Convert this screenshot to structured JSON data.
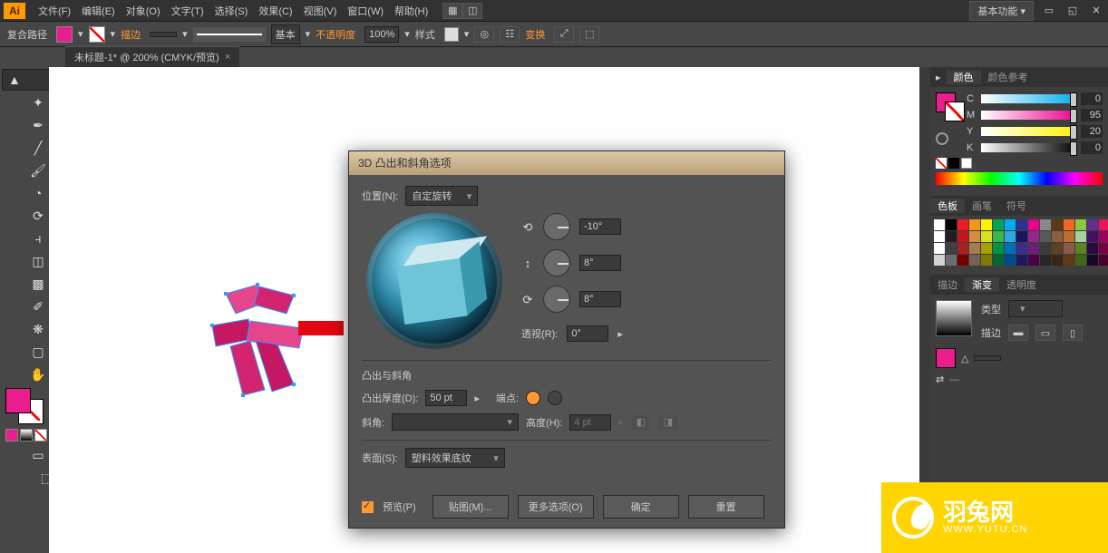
{
  "menubar": {
    "items": [
      "文件(F)",
      "编辑(E)",
      "对象(O)",
      "文字(T)",
      "选择(S)",
      "效果(C)",
      "视图(V)",
      "窗口(W)",
      "帮助(H)"
    ],
    "basic": "基本功能"
  },
  "controlbar": {
    "mode": "复合路径",
    "stroke_label": "描边",
    "stroke_val": "",
    "basic": "基本",
    "opacity_label": "不透明度",
    "opacity_val": "100%",
    "style_label": "样式",
    "transform_label": "变换"
  },
  "doc_tab": "未标题-1* @ 200% (CMYK/预览)",
  "panels": {
    "color": {
      "tab": "颜色",
      "guide": "颜色参考",
      "c": "C",
      "m": "M",
      "y": "Y",
      "k": "K",
      "cv": "0",
      "mv": "95",
      "yv": "20",
      "kv": "0"
    },
    "swatches": {
      "tabs": [
        "色板",
        "画笔",
        "符号"
      ]
    },
    "stroke": {
      "tabs": [
        "描边",
        "渐变",
        "透明度"
      ],
      "type": "类型",
      "edge": "描边"
    }
  },
  "dialog": {
    "title": "3D 凸出和斜角选项",
    "pos_label": "位置(N):",
    "pos_val": "自定旋转",
    "rx": "-10°",
    "ry": "8°",
    "rz": "8°",
    "persp_label": "透视(R):",
    "persp_val": "0°",
    "section2": "凸出与斜角",
    "depth_label": "凸出厚度(D):",
    "depth_val": "50 pt",
    "cap_label": "端点:",
    "bevel_label": "斜角:",
    "bevel_val": "",
    "height_label": "高度(H):",
    "height_val": "4 pt",
    "surface_label": "表面(S):",
    "surface_val": "塑料效果底纹",
    "preview": "预览(P)",
    "map": "贴图(M)...",
    "more": "更多选项(O)",
    "ok": "确定",
    "reset": "重置"
  },
  "yutu": {
    "name": "羽兔网",
    "url": "WWW.YUTU.CN"
  },
  "swatches_colors": [
    "#fff",
    "#000",
    "#ed1c24",
    "#f7941d",
    "#fff200",
    "#00a651",
    "#00aeef",
    "#2e3192",
    "#ec008c",
    "#898989",
    "#603913",
    "#f26522",
    "#8dc63f",
    "#662d91",
    "#ed145b",
    "#fff",
    "#231f20",
    "#c4161c",
    "#cf9044",
    "#d7df23",
    "#39b54a",
    "#27aae1",
    "#1b1464",
    "#92278f",
    "#58595b",
    "#8b5e3c",
    "#bf6c2c",
    "#a3d39c",
    "#440e62",
    "#9e005d",
    "#ffffff",
    "#414042",
    "#a91f23",
    "#a67c52",
    "#aba000",
    "#009444",
    "#0072bc",
    "#3a2e8f",
    "#6c2079",
    "#3b3b3b",
    "#5e4123",
    "#8a5a44",
    "#598527",
    "#2b0a3d",
    "#790043",
    "#d1d3d4",
    "#6d6e71",
    "#790000",
    "#736357",
    "#827b00",
    "#006838",
    "#004b8d",
    "#211564",
    "#4b0049",
    "#262626",
    "#3c2415",
    "#603813",
    "#406618",
    "#1a0626",
    "#4d002b"
  ]
}
